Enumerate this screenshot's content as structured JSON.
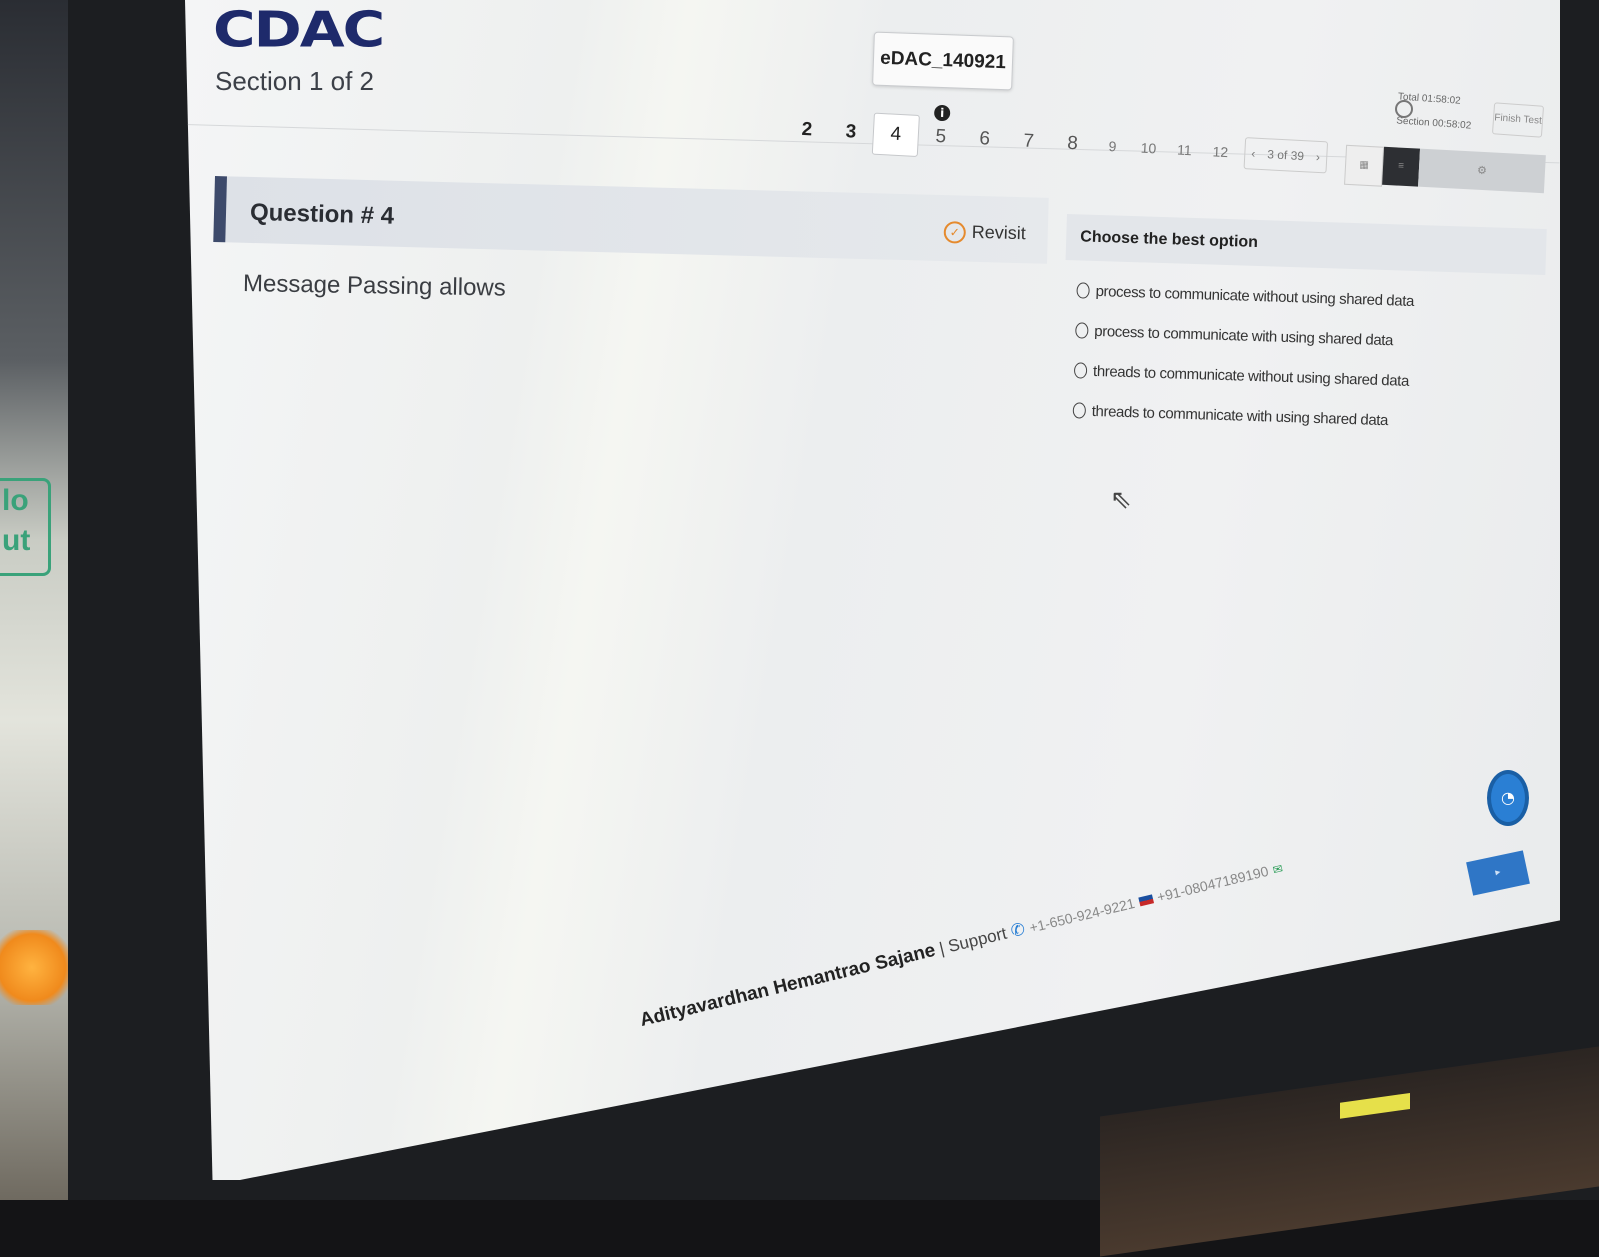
{
  "header": {
    "logo_text": "CDAC",
    "section_label": "Section 1 of 2",
    "exam_code": "eDAC_140921"
  },
  "question_nav": {
    "numbers": [
      "2",
      "3",
      "4",
      "5",
      "6",
      "7",
      "8",
      "9",
      "10",
      "11",
      "12"
    ],
    "current": "4",
    "prev_label": "‹",
    "page_indicator": "3 of 39",
    "next_label": "›"
  },
  "timer": {
    "total_label": "Total 01:58:02",
    "section_label": "Section 00:58:02",
    "finish_label": "Finish Test"
  },
  "question": {
    "title": "Question # 4",
    "revisit_label": "Revisit",
    "text": "Message Passing allows"
  },
  "options": {
    "header": "Choose the best option",
    "items": [
      "process to communicate without using shared data",
      "process to communicate with using shared data",
      "threads to communicate without using shared data",
      "threads to communicate with using shared data"
    ]
  },
  "footer": {
    "candidate_name": "Adityavardhan Hemantrao Sajane",
    "separator": "|",
    "support_label": "Support",
    "phone_us": "+1-650-924-9221",
    "phone_in": "+91-08047189190"
  },
  "icons": {
    "info": "info-icon",
    "revisit": "revisit-icon",
    "clock": "clock-icon",
    "phone": "phone-icon",
    "flag": "flag-icon",
    "whatsapp": "whatsapp-icon",
    "chat": "chat-icon",
    "cursor": "mouse-cursor-icon"
  },
  "colors": {
    "brand_navy": "#1e2a6b",
    "question_accent": "#3d4a6b",
    "revisit_orange": "#e58a2e",
    "chat_blue": "#2a7fd4"
  }
}
